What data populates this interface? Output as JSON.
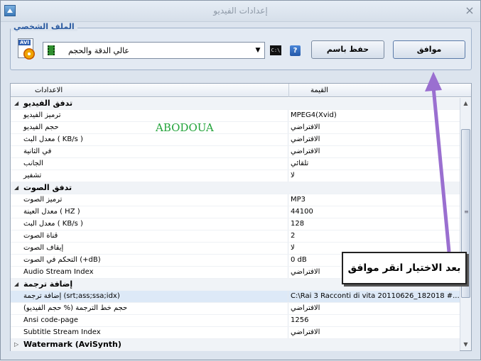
{
  "window": {
    "title": "إعدادات الفيديو",
    "close_glyph": "×"
  },
  "profile": {
    "legend": "الملف الشخصي",
    "icon_label": "AVI",
    "selected": "عالي الدقة والحجم",
    "cmd_label": "C:\\",
    "help_label": "?",
    "save_as_label": "حفظ باسم",
    "ok_label": "موافق"
  },
  "grid": {
    "header_settings": "الاعدادات",
    "header_value": "القيمة",
    "rows": [
      {
        "type": "category",
        "name": "تدفق الفيديو",
        "expander": "◢"
      },
      {
        "type": "item",
        "name": "ترميز الفيديو",
        "value": "MPEG4(Xvid)"
      },
      {
        "type": "item",
        "name": "حجم الفيديو",
        "value": "الافتراضي"
      },
      {
        "type": "item",
        "name": "معدل البث ( KB/s )",
        "value": "الافتراضي"
      },
      {
        "type": "item",
        "name": "في الثانية",
        "value": "الافتراضي"
      },
      {
        "type": "item",
        "name": "الجانب",
        "value": "تلقائي"
      },
      {
        "type": "item",
        "name": "تشفير",
        "value": "لا"
      },
      {
        "type": "category",
        "name": "تدفق الصوت",
        "expander": "◢"
      },
      {
        "type": "item",
        "name": "ترميز الصوت",
        "value": "MP3"
      },
      {
        "type": "item",
        "name": "معدل العينة ( HZ )",
        "value": "44100"
      },
      {
        "type": "item",
        "name": "معدل البث ( KB/s )",
        "value": "128"
      },
      {
        "type": "item",
        "name": "قناة الصوت",
        "value": "2"
      },
      {
        "type": "item",
        "name": "إيقاف الصوت",
        "value": "لا"
      },
      {
        "type": "item",
        "name": "التحكم في الصوت (+dB)",
        "value": "0 dB"
      },
      {
        "type": "item",
        "name": "Audio Stream Index",
        "value": "الافتراضي"
      },
      {
        "type": "category",
        "name": "إضافة ترجمة",
        "expander": "◢"
      },
      {
        "type": "item",
        "name": "إضافة ترجمة (srt;ass;ssa;idx)",
        "value": "C:\\Rai 3 Racconti di vita 20110626_182018 #....",
        "selected": true
      },
      {
        "type": "item",
        "name": "حجم خط الترجمة (% حجم الفيديو)",
        "value": "الافتراضي"
      },
      {
        "type": "item",
        "name": "Ansi code-page",
        "value": "1256"
      },
      {
        "type": "item",
        "name": "Subtitle Stream Index",
        "value": "الافتراضي"
      },
      {
        "type": "category",
        "name": "Watermark (AviSynth)",
        "expander": "▷"
      }
    ],
    "scroll_up": "▲",
    "scroll_down": "▼",
    "scroll_grip": "≡"
  },
  "overlay": {
    "watermark": "ABODOUA",
    "instruction": "بعد الاختيار انقر موافق",
    "arrow_color": "#9a6fd0"
  }
}
